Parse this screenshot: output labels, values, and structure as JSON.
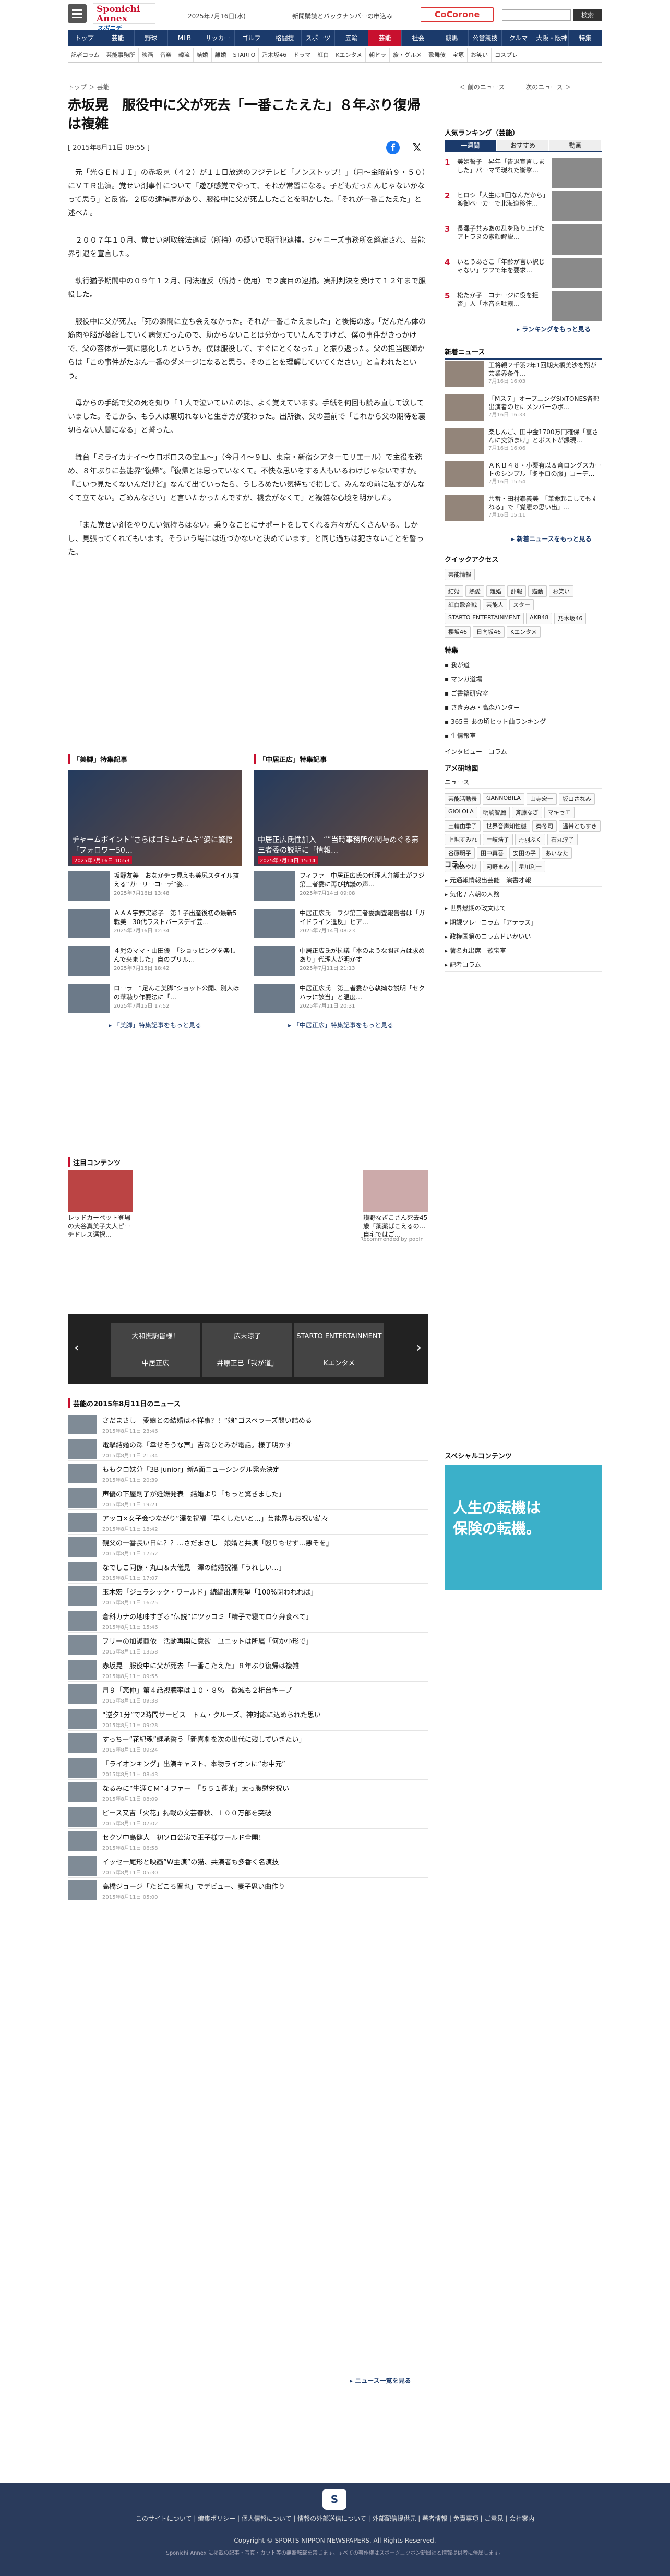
{
  "header": {
    "logo": "Sponichi Annex",
    "date": "2025年7月16日(水)",
    "notice": "新聞購読とバックナンバーの申込み",
    "cocorone": "CoCorone",
    "search_btn": "検索"
  },
  "nav": [
    "トップ",
    "芸能",
    "野球",
    "MLB",
    "サッカー",
    "ゴルフ",
    "格闘技",
    "スポーツ",
    "五輪",
    "芸能",
    "社会",
    "競馬",
    "公営競技",
    "クルマ",
    "大阪・阪神",
    "特集"
  ],
  "nav_active_index": 9,
  "subnav": [
    "記者コラム",
    "芸能事務所",
    "映画",
    "音楽",
    "韓流",
    "結婚",
    "離婚",
    "STARTO",
    "乃木坂46",
    "ドラマ",
    "紅白",
    "Kエンタメ",
    "朝ドラ",
    "旅・グルメ",
    "歌舞伎",
    "宝塚",
    "お笑い",
    "コスプレ"
  ],
  "breadcrumb": "トップ ＞ 芸能",
  "prev": "＜ 前のニュース",
  "next": "次のニュース ＞",
  "article": {
    "headline": "赤坂晃　服役中に父が死去「一番こたえた」８年ぶり復帰は複雑",
    "date": "[ 2015年8月11日 09:55 ]",
    "paragraphs": [
      "元「光ＧＥＮＪＩ」の赤坂晃（４２）が１１日放送のフジテレビ「ノンストップ！」（月～金曜前９・５０）にＶＴＲ出演。覚せい剤事件について「遊び感覚でやって、それが常習になる。子どもだったんじゃないかなって思う」と反省。２度の逮捕歴があり、服役中に父が死去したことを明かした。「それが一番こたえた」と述べた。",
      "２００７年１０月、覚せい剤取締法違反（所持）の疑いで現行犯逮捕。ジャニーズ事務所を解雇され、芸能界引退を宣言した。",
      "執行猶予期間中の０９年１２月、同法違反（所持・使用）で２度目の逮捕。実刑判決を受けて１２年まで服役した。",
      "服役中に父が死去。「死の瞬間に立ち会えなかった。それが一番こたえました」と後悔の念。「だんだん体の筋肉や脳が萎縮していく病気だったので、助からないことは分かっていたんですけど、僕の事件がきっかけで、父の容体が一気に悪化したというか。僕は服役して、すぐにとくなった」と振り返った。父の担当医師からは「この事件がたぶん一番のダメージになると思う。そのことを理解していてください」と言われたという。",
      "母からの手紙で父の死を知り「１人で泣いていたのは、よく覚えています。手紙を何回も読み直して涙していました。そこから、もう人は裏切れないと生き方が変わった。出所後、父の墓前で「これから父の期待を裏切らない人間になる」と誓った。",
      "舞台「ミライカナイ〜ウロボロスの宝玉〜」（今月４〜９日、東京・新宿シアターモリエール）で主役を務め、８年ぶりに芸能界”復帰”。「復帰とは思っていなくて。不快な思いをする人もいるわけじゃないですか。『こいつ見たくないんだけど』なんて出ていったら、うしろめたい気持ちで損して、みんなの前に私すがんなくて立てない。ごめんなさい」と言いたかったんですが、機会がなくて」と複雑な心境を明かした。",
      "「また覚せい剤をやりたい気持ちはない。乗りなことにサポートをしてくれる方々がたくさんいる。しかし、見張ってくれてもいます。そういう場には近づかないと決めています」と同じ過ちは犯さないことを誓った。"
    ]
  },
  "feature_left": {
    "header": "「美脚」特集記事",
    "main_caption": "チャームポイント”さらばゴミムキムキ”姿に驚愕「フォロワー50…",
    "main_date": "2025年7月16日 10:53",
    "items": [
      {
        "t": "坂野友美　おなかチラ見えも美尻スタイル抜える“ガーリーコーデ”姿…",
        "d": "2025年7月16日 13:48"
      },
      {
        "t": "ＡＡＡ宇野実彩子　第１子出産後初の最新5戦美　30代ラストバースデイ芸…",
        "d": "2025年7月16日 12:34"
      },
      {
        "t": "４児のママ・山田優　「ショッピングを楽しんで来ました」自のプリル…",
        "d": "2025年7月15日 18:42"
      },
      {
        "t": "ローラ　“足んこ美脚”ショット公開、別人ほの華聴り作要法に「…",
        "d": "2025年7月15日 17:52"
      }
    ],
    "more": "「美脚」特集記事をもっと見る"
  },
  "feature_right": {
    "header": "「中居正広」特集記事",
    "main_caption": "中居正広氏性加入　“”当時事務所の関与めぐる第三者委の説明に「情報…",
    "main_date": "2025年7月14日 15:14",
    "items": [
      {
        "t": "フィファ　中居正広氏の代理人弁護士がフジ第三者委に再び抗議の声…",
        "d": "2025年7月14日 09:08"
      },
      {
        "t": "中居正広氏　フジ第三者委調査報告書は「ガイドライン違反」ヒア…",
        "d": "2025年7月14日 08:23"
      },
      {
        "t": "中居正広氏が抗議「本のような関き方は求めあり」代理人が明かす",
        "d": "2025年7月11日 21:13"
      },
      {
        "t": "中居正広氏　第三者委から執拗な説明「セクハラに該当」と温度…",
        "d": "2025年7月11日 20:31"
      }
    ],
    "more": "「中居正広」特集記事をもっと見る"
  },
  "promo": {
    "header": "注目コンテンツ",
    "items": [
      {
        "t": "レッドカーペット登場の大谷真美子夫人ピーチドレス選択…"
      },
      {
        "t": "讃野なぎこさん死去45歳「薬薬ばこえるの…自宅ではご…"
      }
    ],
    "powered": "Recommended by popIn"
  },
  "slider": {
    "tiles": [
      "大和撫駒皆様！",
      "広末涼子",
      "STARTO ENTERTAINMENT",
      "中居正広",
      "井原正巳「我が道」",
      "Kエンタメ"
    ]
  },
  "news": {
    "header": "芸能の2015年8月11日のニュース",
    "items": [
      {
        "t": "さだまさし　愛娘との結婚は不祥事？！“娘”ゴスペラーズ問い詰める",
        "d": "2015年8月11日 23:46"
      },
      {
        "t": "電撃結婚の澤「幸せそうな声」吉澤ひとみが電話。様子明かす",
        "d": "2015年8月11日 21:34"
      },
      {
        "t": "ももクロ妹分「3B junior」新A面ニューシングル発売決定",
        "d": "2015年8月11日 20:39"
      },
      {
        "t": "声優の下屋則子が妊娠発表　結婚より「もっと驚きました」",
        "d": "2015年8月11日 19:21"
      },
      {
        "t": "アッコ×女子会つながり”澤を祝福「早くしたいと…」芸能界もお祝い続々",
        "d": "2015年8月11日 18:42"
      },
      {
        "t": "親父の一番長い日に？？…さだまさし　娘婿と共演「殴りもせず…悪そを」",
        "d": "2015年8月11日 17:52"
      },
      {
        "t": "なでしこ同僚・丸山＆大儀見　澤の結婚祝福「うれしい…」",
        "d": "2015年8月11日 17:07"
      },
      {
        "t": "玉木宏「ジュラシック・ワールド」続編出演熱望「100%閉われれば」",
        "d": "2015年8月11日 16:25"
      },
      {
        "t": "倉科カナの地味すぎる“伝説”にツッコミ「精子で寝てロケ弁食べて」",
        "d": "2015年8月11日 15:46"
      },
      {
        "t": "フリーの加護亜依　活動再開に意欲　ユニットは所属「何か小形で」",
        "d": "2015年8月11日 13:58"
      },
      {
        "t": "赤坂晃　服役中に父が死去「一番こたえた」８年ぶり復帰は複雑",
        "d": "2015年8月11日 09:55"
      },
      {
        "t": "月９「恋仲」第４話視聴率は１０・８％　微減も２桁台キープ",
        "d": "2015年8月11日 09:38"
      },
      {
        "t": "“逆夕1分”で2時間サービス　トム・クルーズ、神対応に込められた思い",
        "d": "2015年8月11日 09:28"
      },
      {
        "t": "すっちー“花紀魂”継承誓う「新喜劇を次の世代に残していきたい」",
        "d": "2015年8月11日 09:24"
      },
      {
        "t": "「ライオンキング」出演キャスト、本物ライオンに“お中元”",
        "d": "2015年8月11日 08:43"
      },
      {
        "t": "なるみに“生涯ＣＭ”オファー　「５５１蓬莱」太っ腹慰労祝い",
        "d": "2015年8月11日 08:09"
      },
      {
        "t": "ピース又吉「火花」掲載の文芸春秋、１００万部を突破",
        "d": "2015年8月11日 07:02"
      },
      {
        "t": "セクゾ中島健人　初ソロ公演で王子様ワールド全開！",
        "d": "2015年8月11日 06:58"
      },
      {
        "t": "イッセー尾形と映画”W主演”の猫、共演者も多香く名演技",
        "d": "2015年8月11日 05:30"
      },
      {
        "t": "高橋ジョージ「たどころ晋也」でデビュー、妻子思い曲作り",
        "d": "2015年8月11日 05:00"
      }
    ],
    "more": "ニュース一覧を見る"
  },
  "sidebar": {
    "ranking_header": "人気ランキング（芸能）",
    "ranking_tabs": [
      "一週間",
      "おすすめ",
      "動画"
    ],
    "ranking": [
      {
        "n": "1",
        "t": "美姫誓子　昇年「告退宣言しました」パーマで現れた衝撃…"
      },
      {
        "n": "2",
        "t": "ヒロシ「人生は1回なんだから」渡御ベーカーで北海道移住…"
      },
      {
        "n": "3",
        "t": "長澤子共みあの乱を取り上げたアトラヌの素顔解説…"
      },
      {
        "n": "4",
        "t": "いとうあさこ「年齢が言い訳じゃない」ワフで年を要求…"
      },
      {
        "n": "5",
        "t": "松たか子　コナージに役を拒否」人「本音を吐露…"
      }
    ],
    "ranking_more": "ランキングをもっと見る",
    "snews_header": "新着ニュース",
    "snews": [
      {
        "t": "王将親２千羽2年1回期大橋美沙を翔が芸業界条件…",
        "d": "7月16日 16:03"
      },
      {
        "t": "「Mステ」オープニングSixTONES各部出演者のせにメンバーのボ…",
        "d": "7月16日 16:33"
      },
      {
        "t": "楽しんご、田中金1700万円確保「裏さんに交節まけ」とポストが課現…",
        "d": "7月16日 16:06"
      },
      {
        "t": "ＡＫＢ４８・小栗有以＆倉ロングスカートのシンプル「冬季ロの服」コーデ…",
        "d": "7月16日 15:54"
      },
      {
        "t": "共番・田村泰義美　「革命起こしてもすねる」で「覚憲の思い出」…",
        "d": "7月16日 15:11"
      }
    ],
    "snews_more": "新着ニュースをもっと見る",
    "qa_header": "クイックアクセス",
    "qa_top": [
      "芸能情報"
    ],
    "qa_rows": [
      "結婚",
      "熱愛",
      "離婚",
      "訃報",
      "猫動",
      "お笑い",
      "紅白歌合戦",
      "芸能人",
      "スター",
      "STARTO ENTERTAINMENT",
      "AKB48",
      "乃木坂46",
      "櫻坂46",
      "日向坂46",
      "Kエンタメ"
    ],
    "tok_header": "特集",
    "toku": [
      "我が道",
      "マンガ道場",
      "ご書籍研究室",
      "さきみみ・高森ハンター",
      "365日 あの頃ヒット曲ランキング",
      "生情報室"
    ],
    "tok_extra": "インタビュー　コラム",
    "anime_header": "アメ研地図",
    "anime_top": [
      "ニュース"
    ],
    "anime_names": [
      "芸能活動表",
      "GANNOBILA",
      "山寺宏一",
      "坂口さなみ",
      "GIOLOLA",
      "明駒智麗",
      "斉藤なぎ",
      "マキセエ",
      "三輪由季子",
      "世界音声知性態",
      "秦冬司",
      "温帯ともすき",
      "上堀すみれ",
      "土岐浩子",
      "丹羽ぶく",
      "石丸淳子",
      "谷藤明子",
      "田中真吾",
      "安田の子",
      "あいなた",
      "小松あやけ",
      "河野まみ",
      "星川利一"
    ],
    "column_header": "コラム",
    "columns": [
      "元通報情報出芸能　演書才報",
      "気化 / 六朝の人務",
      "世界燃期の政文はて",
      "期課ツレーコラム「アテラス」",
      "政権国第のコラムドいかいい",
      "薯名丸出席　歌宝室",
      "記者コラム"
    ],
    "special_header": "スペシャルコンテンツ",
    "special_t1": "人生の転機は",
    "special_t2": "保険の転機。"
  },
  "footer": {
    "links": "このサイトについて | 編集ポリシー | 個人情報について | 情報の外部送信について | 外部配信提供元 | 著者情報 | 免責事項 | ご意見 | 会社案内",
    "copyright": "Copyright © SPORTS NIPPON NEWSPAPERS. All Rights Reserved.",
    "note": "Sponichi Annex に掲載の記事・写真・カット等の無断転載を禁じます。すべての著作権はスポーツニッポン新聞社と情報提供者に帰属します。"
  }
}
